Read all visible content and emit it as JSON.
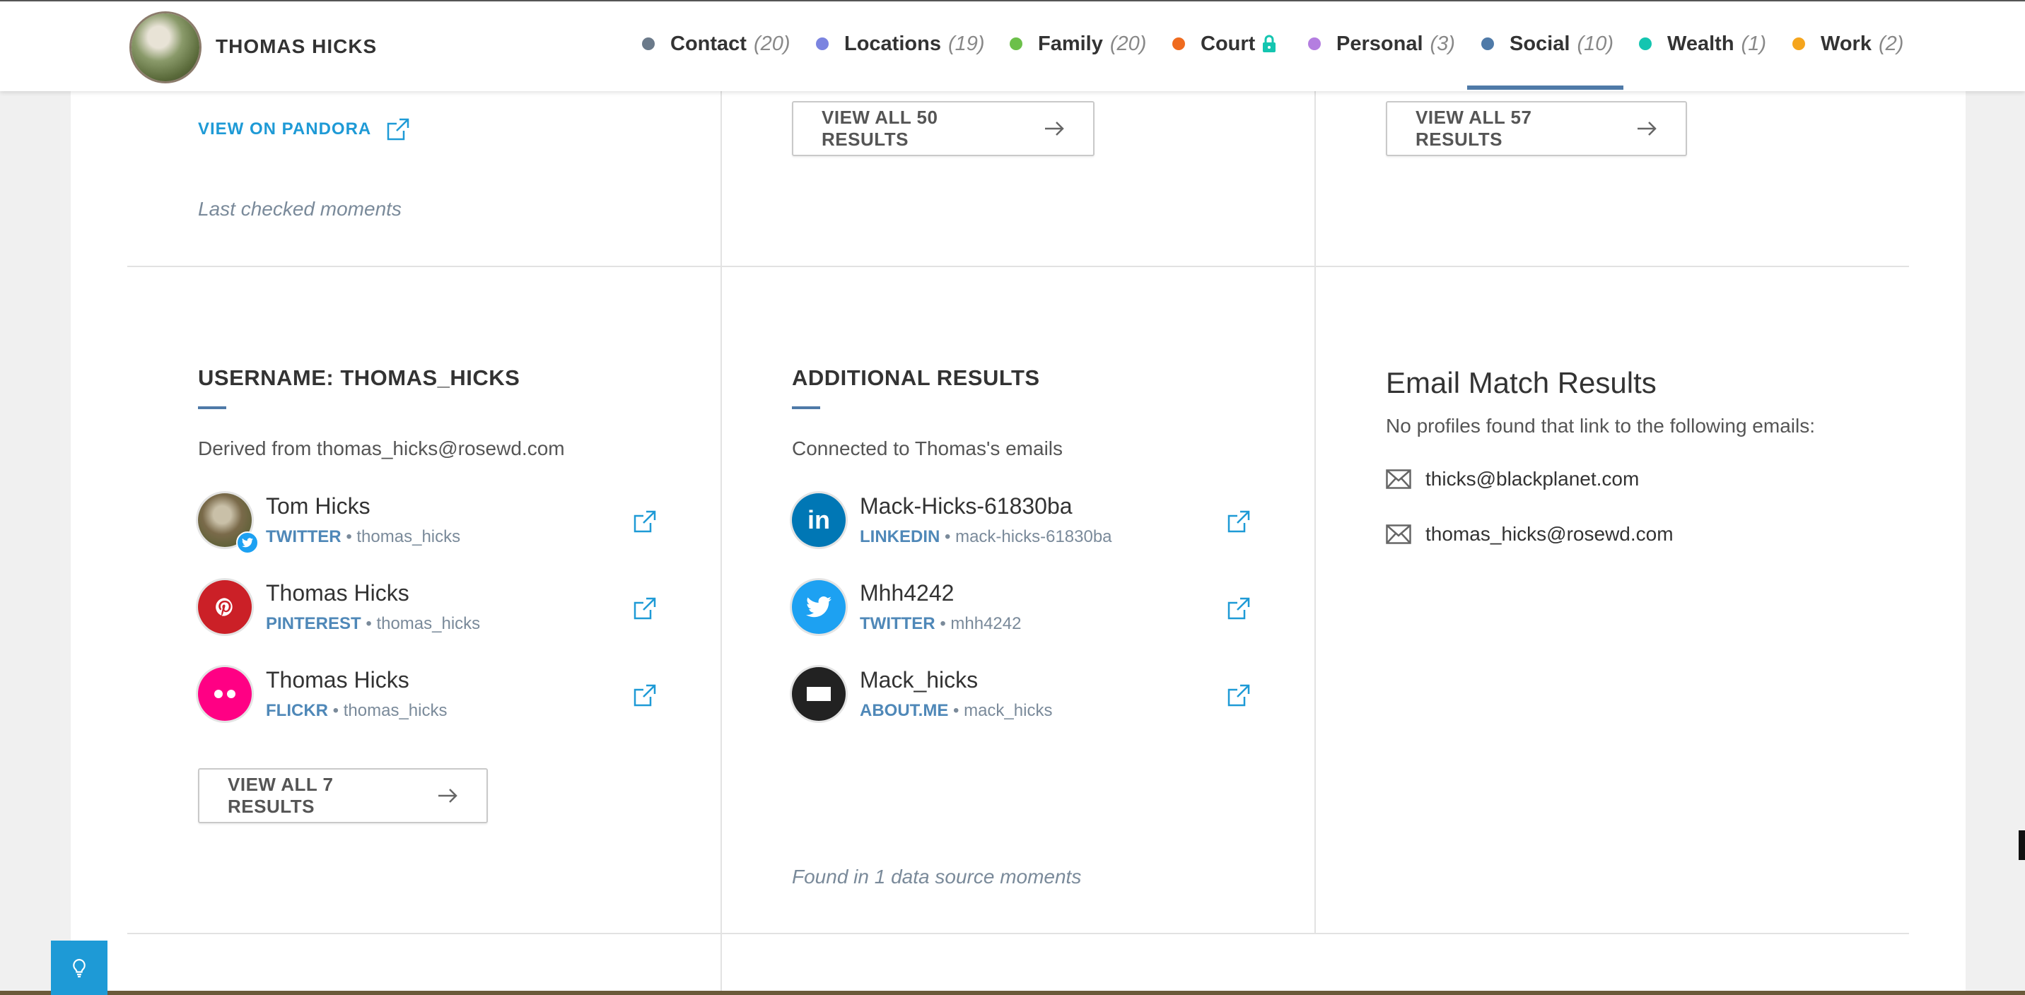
{
  "header": {
    "name": "THOMAS HICKS",
    "nav": [
      {
        "label": "Contact",
        "count": "(20)",
        "color": "#6b7a8a"
      },
      {
        "label": "Locations",
        "count": "(19)",
        "color": "#7b84e0"
      },
      {
        "label": "Family",
        "count": "(20)",
        "color": "#6cc04a"
      },
      {
        "label": "Court",
        "count": "",
        "color": "#ef6b1f",
        "icon": "lock-icon"
      },
      {
        "label": "Personal",
        "count": "(3)",
        "color": "#b47ee0"
      },
      {
        "label": "Social",
        "count": "(10)",
        "color": "#4f7aa8",
        "active": true
      },
      {
        "label": "Wealth",
        "count": "(1)",
        "color": "#14c5b0"
      },
      {
        "label": "Work",
        "count": "(2)",
        "color": "#f5a51d"
      }
    ]
  },
  "top_row": {
    "pandora_link": "VIEW ON PANDORA",
    "last_checked": "Last checked moments",
    "view_all_50": "VIEW ALL 50 RESULTS",
    "view_all_57": "VIEW ALL 57 RESULTS"
  },
  "username_section": {
    "title": "USERNAME: THOMAS_HICKS",
    "derived": "Derived from thomas_hicks@rosewd.com",
    "profiles": [
      {
        "name": "Tom Hicks",
        "network": "TWITTER",
        "handle": "thomas_hicks",
        "icon": "twitter-badge-icon"
      },
      {
        "name": "Thomas Hicks",
        "network": "PINTEREST",
        "handle": "thomas_hicks",
        "icon": "pinterest-icon"
      },
      {
        "name": "Thomas Hicks",
        "network": "FLICKR",
        "handle": "thomas_hicks",
        "icon": "flickr-icon"
      }
    ],
    "view_all": "VIEW ALL 7 RESULTS"
  },
  "additional_section": {
    "title": "ADDITIONAL RESULTS",
    "connected": "Connected to Thomas's emails",
    "profiles": [
      {
        "name": "Mack-Hicks-61830ba",
        "network": "LINKEDIN",
        "handle": "mack-hicks-61830ba",
        "icon": "linkedin-icon"
      },
      {
        "name": "Mhh4242",
        "network": "TWITTER",
        "handle": "mhh4242",
        "icon": "twitter-icon"
      },
      {
        "name": "Mack_hicks",
        "network": "ABOUT.ME",
        "handle": "mack_hicks",
        "icon": "aboutme-icon"
      }
    ],
    "found_in": "Found in 1 data source moments"
  },
  "email_section": {
    "title": "Email Match Results",
    "desc": "No profiles found that link to the following emails:",
    "emails": [
      "thicks@blackplanet.com",
      "thomas_hicks@rosewd.com"
    ]
  },
  "separator": "•"
}
